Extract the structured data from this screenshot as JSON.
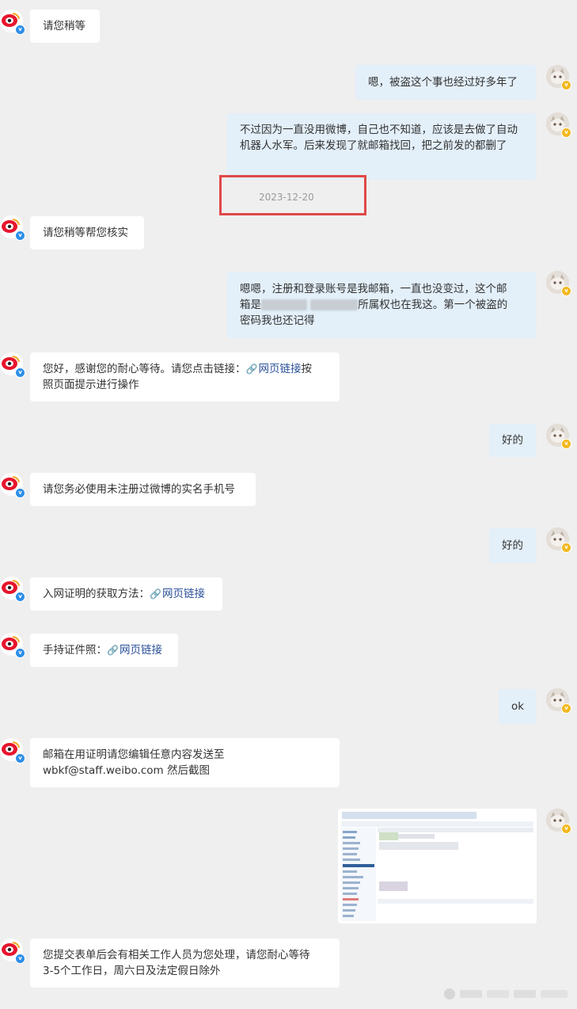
{
  "messages": [
    {
      "side": "left",
      "text": "请您稍等"
    },
    {
      "side": "right",
      "text": "嗯，被盗这个事也经过好多年了"
    },
    {
      "side": "right",
      "text": "不过因为一直没用微博，自己也不知道，应该是去做了自动机器人水军。后来发现了就邮箱找回，把之前发的都删了"
    },
    {
      "side": "left",
      "text": "请您稍等帮您核实"
    },
    {
      "side": "right",
      "line1": "嗯嗯，注册和登录账号是我邮箱，一直也没变过，这个邮",
      "line2_prefix": "箱是",
      "line2_suffix": "所属权也在我这。第一个被盗的",
      "line3": "密码我也还记得"
    },
    {
      "side": "left",
      "line1_prefix": "您好，感谢您的耐心等待。请您点击链接：",
      "link": "网页链接",
      "line1_suffix": "按",
      "line2": "照页面提示进行操作"
    },
    {
      "side": "right",
      "text": "好的"
    },
    {
      "side": "left",
      "text": "请您务必使用未注册过微博的实名手机号"
    },
    {
      "side": "right",
      "text": "好的"
    },
    {
      "side": "left",
      "prefix": "入网证明的获取方法：",
      "link": "网页链接"
    },
    {
      "side": "left",
      "prefix": "手持证件照：",
      "link": "网页链接"
    },
    {
      "side": "right",
      "text": "ok"
    },
    {
      "side": "left",
      "line1": "邮箱在用证明请您编辑任意内容发送至",
      "line2": "wbkf@staff.weibo.com 然后截图"
    },
    {
      "side": "left",
      "line1": "您提交表单后会有相关工作人员为您处理，请您耐心等待",
      "line2": "3-5个工作日，周六日及法定假日除外"
    }
  ],
  "date_separator": "2023-12-20",
  "icons": {
    "link": "link-icon",
    "weibo_avatar": "weibo-eye-logo",
    "user_avatar": "cat-avatar",
    "verified": "verified-badge"
  },
  "colors": {
    "background": "#efefef",
    "left_bubble": "#ffffff",
    "right_bubble": "#e3eff9",
    "link": "#2a4f99",
    "highlight_box": "#e04848"
  }
}
